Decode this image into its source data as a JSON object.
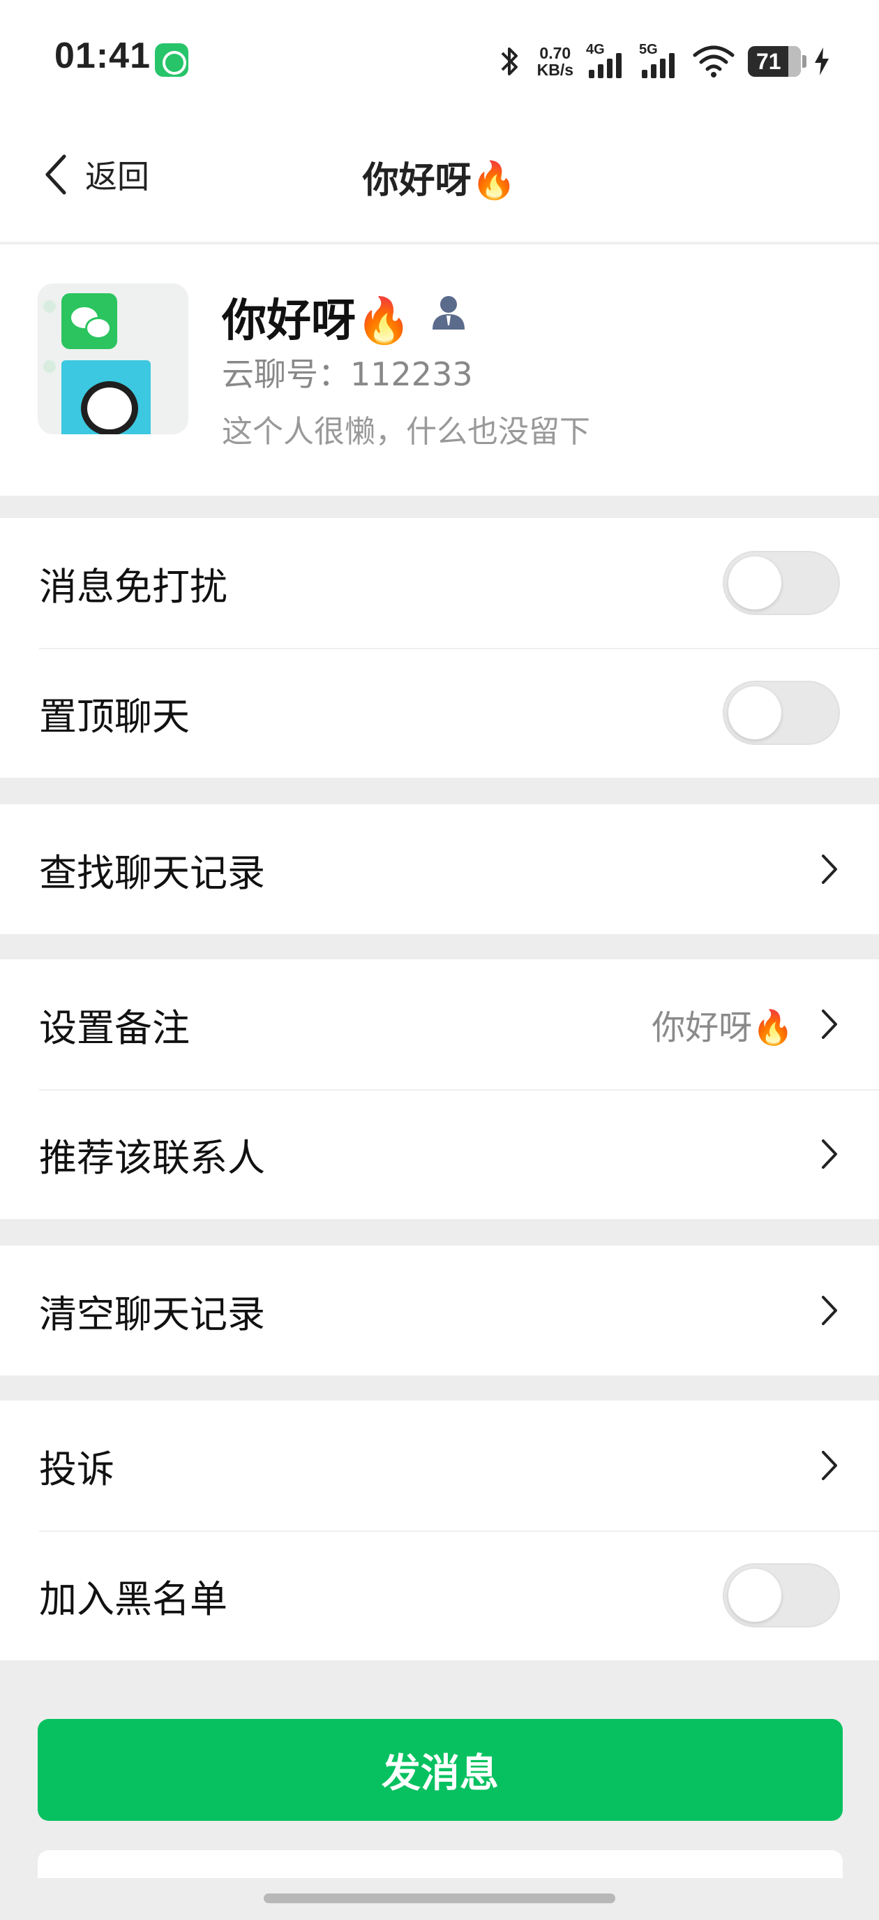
{
  "status_bar": {
    "time": "01:41",
    "net_speed_value": "0.70",
    "net_speed_unit": "KB/s",
    "signal1_label": "4G",
    "signal2_label": "5G",
    "battery": "71"
  },
  "nav": {
    "back_label": "返回",
    "title": "你好呀🔥"
  },
  "profile": {
    "name": "你好呀🔥",
    "id_text": "云聊号：112233",
    "signature": "这个人很懒，什么也没留下"
  },
  "settings": {
    "mute": {
      "label": "消息免打扰",
      "on": false
    },
    "pin": {
      "label": "置顶聊天",
      "on": false
    },
    "search_history": {
      "label": "查找聊天记录"
    },
    "remark": {
      "label": "设置备注",
      "value": "你好呀🔥"
    },
    "recommend": {
      "label": "推荐该联系人"
    },
    "clear_history": {
      "label": "清空聊天记录"
    },
    "complain": {
      "label": "投诉"
    },
    "blacklist": {
      "label": "加入黑名单",
      "on": false
    }
  },
  "actions": {
    "send_message": "发消息"
  }
}
